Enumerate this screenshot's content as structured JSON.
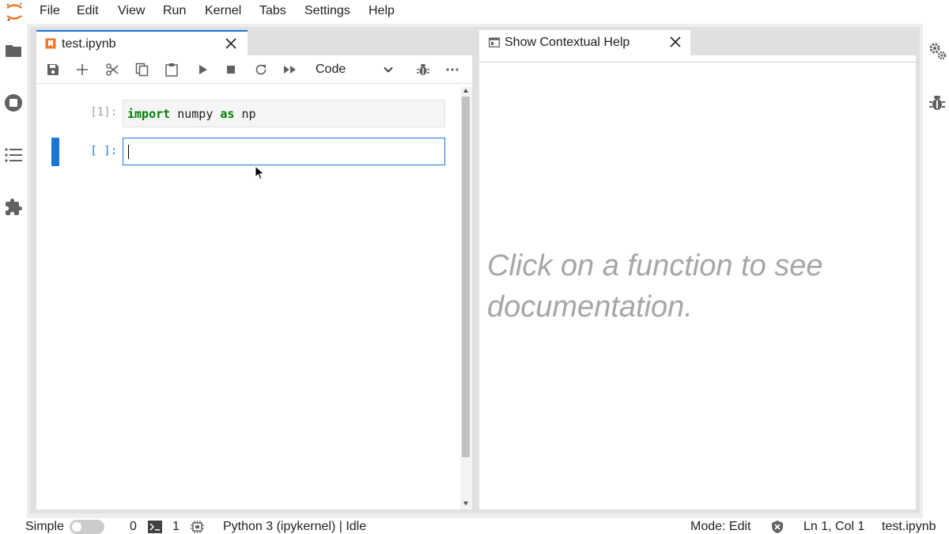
{
  "menubar": {
    "items": [
      "File",
      "Edit",
      "View",
      "Run",
      "Kernel",
      "Tabs",
      "Settings",
      "Help"
    ]
  },
  "left_sidebar": {
    "icons": [
      "folder-icon",
      "running-sessions-icon",
      "table-of-contents-icon",
      "extension-manager-icon"
    ]
  },
  "right_sidebar": {
    "icons": [
      "property-inspector-icon",
      "debugger-icon"
    ]
  },
  "notebook": {
    "tab_title": "test.ipynb",
    "toolbar": {
      "buttons": [
        "save",
        "insert-cell",
        "cut",
        "copy",
        "paste",
        "run",
        "interrupt",
        "restart",
        "restart-run-all"
      ],
      "cell_type": "Code"
    },
    "cells": [
      {
        "prompt": "[1]:",
        "code_parts": [
          "import",
          " numpy ",
          "as",
          " np"
        ]
      },
      {
        "prompt": "[ ]:",
        "code": ""
      }
    ]
  },
  "help": {
    "tab_title": "Show Contextual Help",
    "placeholder": "Click on a function to see documentation."
  },
  "statusbar": {
    "mode_label": "Simple",
    "terminals_count": "0",
    "kernels_count": "1",
    "kernel_status": "Python 3 (ipykernel) | Idle",
    "mode": "Mode: Edit",
    "cursor_position": "Ln 1, Col 1",
    "filename": "test.ipynb"
  },
  "colors": {
    "accent": "#1976d2",
    "keyword": "#008000",
    "icon": "#616161"
  }
}
